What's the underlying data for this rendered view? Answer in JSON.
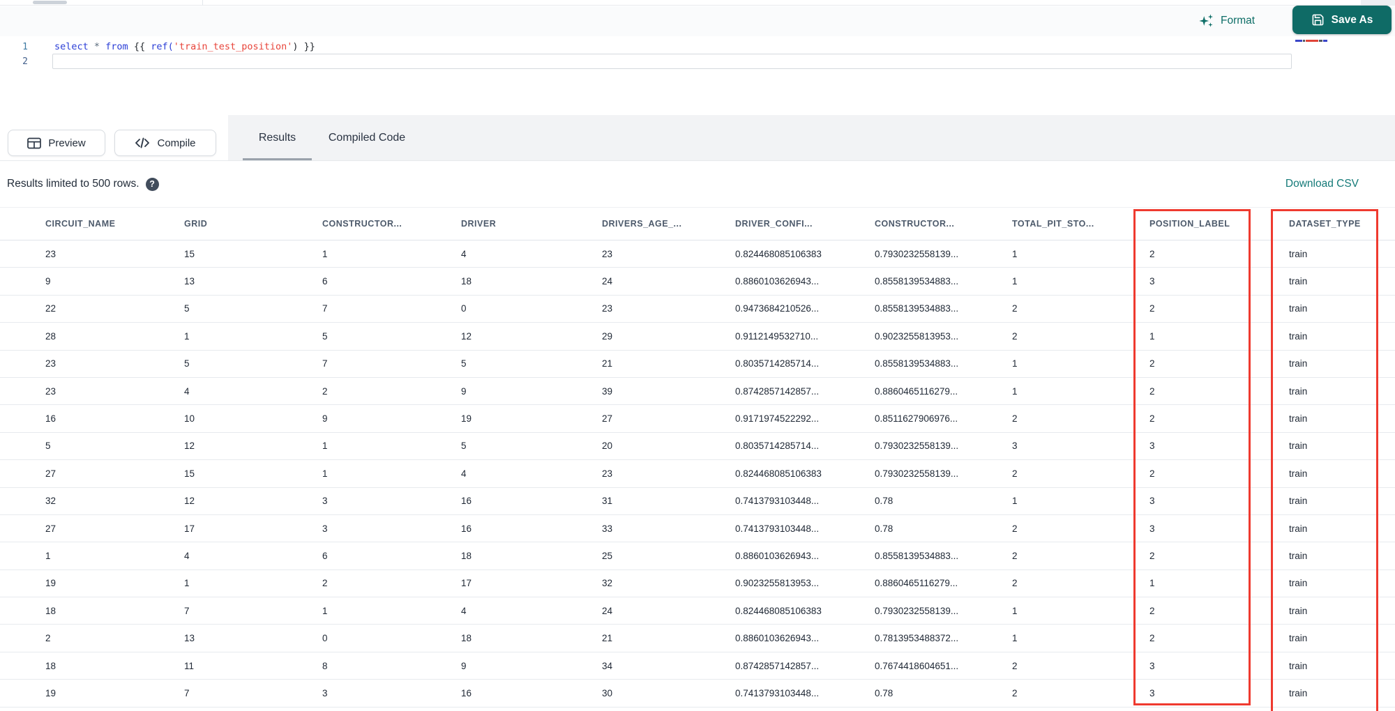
{
  "top_toolbar": {
    "format_label": "Format",
    "save_as_label": "Save As"
  },
  "code_editor": {
    "lines": [
      {
        "number": "1",
        "tokens": [
          {
            "text": "select ",
            "type": "keyword"
          },
          {
            "text": "* ",
            "type": "operator"
          },
          {
            "text": "from ",
            "type": "keyword"
          },
          {
            "text": "{{ ",
            "type": "brace"
          },
          {
            "text": "ref(",
            "type": "function"
          },
          {
            "text": "'train_test_position'",
            "type": "string"
          },
          {
            "text": ") }}",
            "type": "brace"
          }
        ]
      },
      {
        "number": "2",
        "tokens": []
      }
    ]
  },
  "action_bar": {
    "preview_label": "Preview",
    "compile_label": "Compile",
    "tabs": [
      {
        "label": "Results",
        "active": true
      },
      {
        "label": "Compiled Code",
        "active": false
      }
    ]
  },
  "results_bar": {
    "message": "Results limited to 500 rows.",
    "help_glyph": "?",
    "download_label": "Download CSV"
  },
  "results_table": {
    "columns": [
      "CIRCUIT_NAME",
      "GRID",
      "CONSTRUCTOR...",
      "DRIVER",
      "DRIVERS_AGE_...",
      "DRIVER_CONFI...",
      "CONSTRUCTOR...",
      "TOTAL_PIT_STO...",
      "POSITION_LABEL",
      "DATASET_TYPE"
    ],
    "rows": [
      [
        "23",
        "15",
        "1",
        "4",
        "23",
        "0.824468085106383",
        "0.7930232558139...",
        "1",
        "2",
        "train"
      ],
      [
        "9",
        "13",
        "6",
        "18",
        "24",
        "0.8860103626943...",
        "0.8558139534883...",
        "1",
        "3",
        "train"
      ],
      [
        "22",
        "5",
        "7",
        "0",
        "23",
        "0.9473684210526...",
        "0.8558139534883...",
        "2",
        "2",
        "train"
      ],
      [
        "28",
        "1",
        "5",
        "12",
        "29",
        "0.9112149532710...",
        "0.9023255813953...",
        "2",
        "1",
        "train"
      ],
      [
        "23",
        "5",
        "7",
        "5",
        "21",
        "0.8035714285714...",
        "0.8558139534883...",
        "1",
        "2",
        "train"
      ],
      [
        "23",
        "4",
        "2",
        "9",
        "39",
        "0.8742857142857...",
        "0.8860465116279...",
        "1",
        "2",
        "train"
      ],
      [
        "16",
        "10",
        "9",
        "19",
        "27",
        "0.9171974522292...",
        "0.8511627906976...",
        "2",
        "2",
        "train"
      ],
      [
        "5",
        "12",
        "1",
        "5",
        "20",
        "0.8035714285714...",
        "0.7930232558139...",
        "3",
        "3",
        "train"
      ],
      [
        "27",
        "15",
        "1",
        "4",
        "23",
        "0.824468085106383",
        "0.7930232558139...",
        "2",
        "2",
        "train"
      ],
      [
        "32",
        "12",
        "3",
        "16",
        "31",
        "0.7413793103448...",
        "0.78",
        "1",
        "3",
        "train"
      ],
      [
        "27",
        "17",
        "3",
        "16",
        "33",
        "0.7413793103448...",
        "0.78",
        "2",
        "3",
        "train"
      ],
      [
        "1",
        "4",
        "6",
        "18",
        "25",
        "0.8860103626943...",
        "0.8558139534883...",
        "2",
        "2",
        "train"
      ],
      [
        "19",
        "1",
        "2",
        "17",
        "32",
        "0.9023255813953...",
        "0.8860465116279...",
        "2",
        "1",
        "train"
      ],
      [
        "18",
        "7",
        "1",
        "4",
        "24",
        "0.824468085106383",
        "0.7930232558139...",
        "1",
        "2",
        "train"
      ],
      [
        "2",
        "13",
        "0",
        "18",
        "21",
        "0.8860103626943...",
        "0.7813953488372...",
        "1",
        "2",
        "train"
      ],
      [
        "18",
        "11",
        "8",
        "9",
        "34",
        "0.8742857142857...",
        "0.7674418604651...",
        "2",
        "3",
        "train"
      ],
      [
        "19",
        "7",
        "3",
        "16",
        "30",
        "0.7413793103448...",
        "0.78",
        "2",
        "3",
        "train"
      ]
    ]
  },
  "annotations": {
    "highlighted_columns": [
      "POSITION_LABEL",
      "DATASET_TYPE"
    ],
    "highlight_color": "#ef3a2f"
  },
  "colors": {
    "accent_teal": "#0e6e67",
    "save_button_teal": "#0f6b66",
    "link_teal": "#147a78",
    "annotation_red": "#ef3a2f",
    "keyword_blue": "#2b3ed6",
    "string_red": "#e8443a"
  }
}
